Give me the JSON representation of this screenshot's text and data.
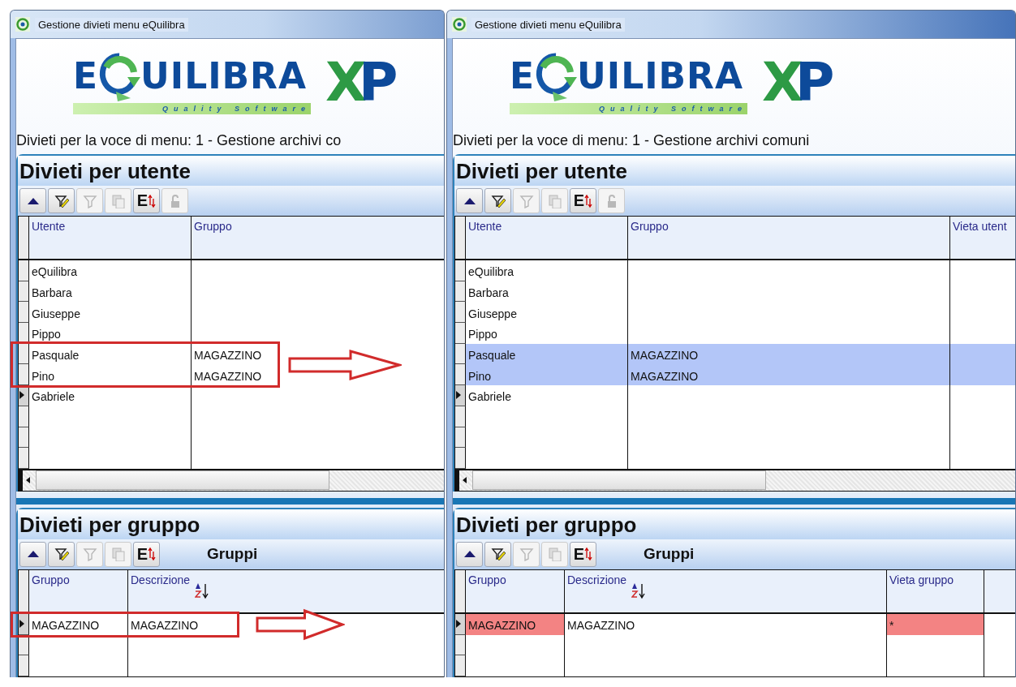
{
  "windows": [
    {
      "title": "Gestione divieti menu eQuilibra",
      "logo": {
        "lead": "E",
        "rest": "UILIBRA",
        "tagline": "Quality Software",
        "mark_x": "X",
        "mark_p": "P"
      },
      "subtitle": "Divieti per la voce di menu: 1 - Gestione archivi co",
      "sections": [
        {
          "title": "Divieti per utente",
          "toolbar": [
            {
              "kind": "up",
              "disabled": false
            },
            {
              "kind": "filter-edit",
              "disabled": false
            },
            {
              "kind": "filter",
              "disabled": true
            },
            {
              "kind": "copy",
              "disabled": true
            },
            {
              "kind": "export",
              "label": "E",
              "disabled": false
            },
            {
              "kind": "lock",
              "disabled": true
            }
          ],
          "grid": {
            "columns": [
              {
                "label": "Utente",
                "sorted": false
              },
              {
                "label": "Gruppo",
                "sorted": false
              }
            ],
            "rows": [
              {
                "cells": [
                  "eQuilibra",
                  ""
                ],
                "selected": false,
                "current": false,
                "marked": false
              },
              {
                "cells": [
                  "Barbara",
                  ""
                ],
                "selected": false,
                "current": false,
                "marked": false
              },
              {
                "cells": [
                  "Giuseppe",
                  ""
                ],
                "selected": false,
                "current": false,
                "marked": false
              },
              {
                "cells": [
                  "Pippo",
                  ""
                ],
                "selected": false,
                "current": false,
                "marked": false
              },
              {
                "cells": [
                  "Pasquale",
                  "MAGAZZINO"
                ],
                "selected": false,
                "current": false,
                "marked": true
              },
              {
                "cells": [
                  "Pino",
                  "MAGAZZINO"
                ],
                "selected": false,
                "current": false,
                "marked": true
              },
              {
                "cells": [
                  "Gabriele",
                  ""
                ],
                "selected": false,
                "current": true,
                "marked": false
              }
            ]
          }
        },
        {
          "title": "Divieti per gruppo",
          "caption": "Gruppi",
          "toolbar": [
            {
              "kind": "up",
              "disabled": false
            },
            {
              "kind": "filter-edit",
              "disabled": false
            },
            {
              "kind": "filter",
              "disabled": true
            },
            {
              "kind": "copy",
              "disabled": true
            },
            {
              "kind": "export",
              "label": "E",
              "disabled": false
            }
          ],
          "grid": {
            "columns": [
              {
                "label": "Gruppo",
                "sorted": false
              },
              {
                "label": "Descrizione",
                "sorted": true
              }
            ],
            "rows": [
              {
                "cells": [
                  "MAGAZZINO",
                  "MAGAZZINO"
                ],
                "selected": false,
                "current": true,
                "marked": true
              }
            ]
          }
        }
      ]
    },
    {
      "title": "Gestione divieti menu eQuilibra",
      "logo": {
        "lead": "E",
        "rest": "UILIBRA",
        "tagline": "Quality Software",
        "mark_x": "X",
        "mark_p": "P"
      },
      "subtitle": "Divieti per la voce di menu: 1 - Gestione archivi comuni",
      "sections": [
        {
          "title": "Divieti per utente",
          "toolbar": [
            {
              "kind": "up",
              "disabled": false
            },
            {
              "kind": "filter-edit",
              "disabled": false
            },
            {
              "kind": "filter",
              "disabled": true
            },
            {
              "kind": "copy",
              "disabled": true
            },
            {
              "kind": "export",
              "label": "E",
              "disabled": false
            },
            {
              "kind": "lock",
              "disabled": true
            }
          ],
          "grid": {
            "columns": [
              {
                "label": "Utente",
                "sorted": false
              },
              {
                "label": "Gruppo",
                "sorted": false
              },
              {
                "label": "Vieta utent",
                "sorted": false
              }
            ],
            "rows": [
              {
                "cells": [
                  "eQuilibra",
                  "",
                  ""
                ],
                "selected": false,
                "current": false
              },
              {
                "cells": [
                  "Barbara",
                  "",
                  ""
                ],
                "selected": false,
                "current": false
              },
              {
                "cells": [
                  "Giuseppe",
                  "",
                  ""
                ],
                "selected": false,
                "current": false
              },
              {
                "cells": [
                  "Pippo",
                  "",
                  ""
                ],
                "selected": false,
                "current": false
              },
              {
                "cells": [
                  "Pasquale",
                  "MAGAZZINO",
                  ""
                ],
                "selected": true,
                "current": false
              },
              {
                "cells": [
                  "Pino",
                  "MAGAZZINO",
                  ""
                ],
                "selected": true,
                "current": false
              },
              {
                "cells": [
                  "Gabriele",
                  "",
                  ""
                ],
                "selected": false,
                "current": true
              }
            ]
          }
        },
        {
          "title": "Divieti per gruppo",
          "caption": "Gruppi",
          "toolbar": [
            {
              "kind": "up",
              "disabled": false
            },
            {
              "kind": "filter-edit",
              "disabled": false
            },
            {
              "kind": "filter",
              "disabled": true
            },
            {
              "kind": "copy",
              "disabled": true
            },
            {
              "kind": "export",
              "label": "E",
              "disabled": false
            }
          ],
          "grid": {
            "columns": [
              {
                "label": "Gruppo",
                "sorted": false
              },
              {
                "label": "Descrizione",
                "sorted": true
              },
              {
                "label": "Vieta gruppo",
                "sorted": false
              }
            ],
            "rows": [
              {
                "cells": [
                  "MAGAZZINO",
                  "MAGAZZINO",
                  "*"
                ],
                "selected": false,
                "current": true,
                "flagged": true
              }
            ]
          }
        }
      ]
    }
  ]
}
